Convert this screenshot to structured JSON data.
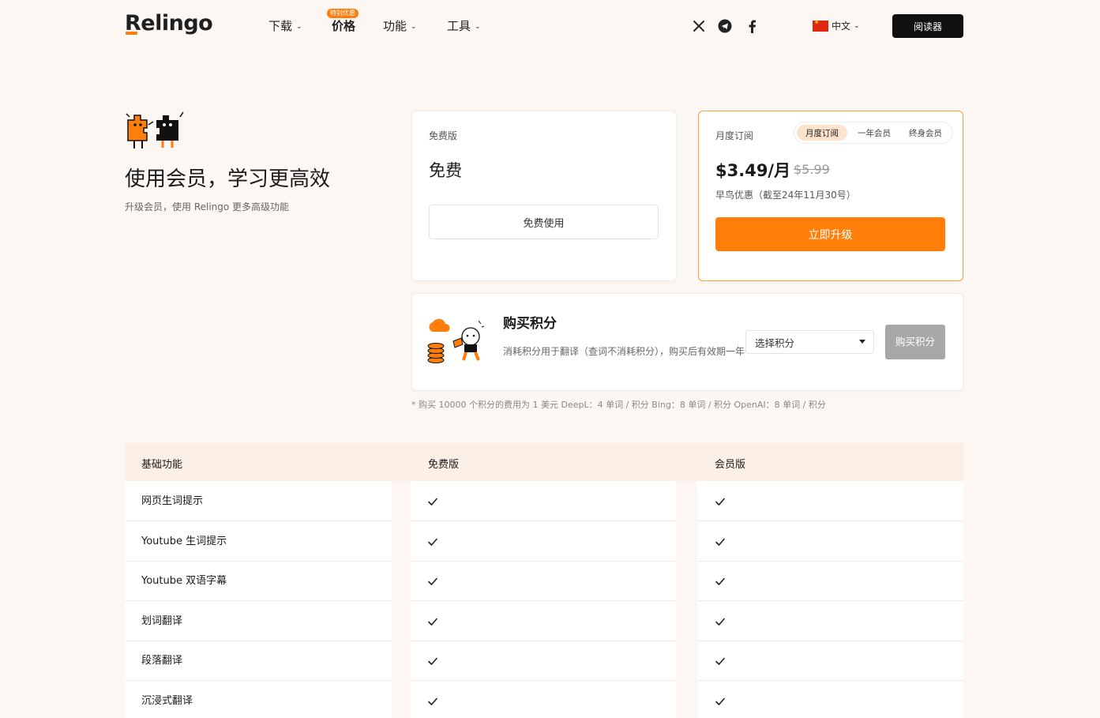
{
  "brand": {
    "name": "Relingo",
    "accent": "#ff7d0a"
  },
  "nav": {
    "download": "下载",
    "pricing": "价格",
    "pricing_badge": "特别优惠",
    "features": "功能",
    "tools": "工具",
    "language": "中文",
    "reader_button": "阅读器",
    "social": [
      "x-icon",
      "telegram-icon",
      "facebook-icon"
    ]
  },
  "hero": {
    "title": "使用会员，学习更高效",
    "subtitle": "升级会员，使用 Relingo 更多高级功能"
  },
  "free_plan": {
    "label": "免费版",
    "title": "免费",
    "button": "免费使用"
  },
  "premium_plan": {
    "label": "月度订阅",
    "tabs": [
      "月度订阅",
      "一年会员",
      "终身会员"
    ],
    "active_tab": "月度订阅",
    "price": "$3.49/月",
    "old_price": "$5.99",
    "promo_note": "早鸟优惠（截至24年11月30号）",
    "button": "立即升级"
  },
  "credits": {
    "title": "购买积分",
    "description": "消耗积分用于翻译（查词不消耗积分），购买后有效期一年",
    "select_placeholder": "选择积分",
    "buy_button": "购买积分",
    "footnote": "* 购买 10000 个积分的费用为 1 美元 DeepL：4 单词 / 积分 Bing：8 单词 / 积分 OpenAI：8 单词 / 积分"
  },
  "feature_table": {
    "headers": [
      "基础功能",
      "免费版",
      "会员版"
    ],
    "rows": [
      {
        "name": "网页生词提示",
        "free": true,
        "premium": true
      },
      {
        "name": "Youtube 生词提示",
        "free": true,
        "premium": true
      },
      {
        "name": "Youtube 双语字幕",
        "free": true,
        "premium": true
      },
      {
        "name": "划词翻译",
        "free": true,
        "premium": true
      },
      {
        "name": "段落翻译",
        "free": true,
        "premium": true
      },
      {
        "name": "沉浸式翻译",
        "free": true,
        "premium": true
      }
    ]
  }
}
